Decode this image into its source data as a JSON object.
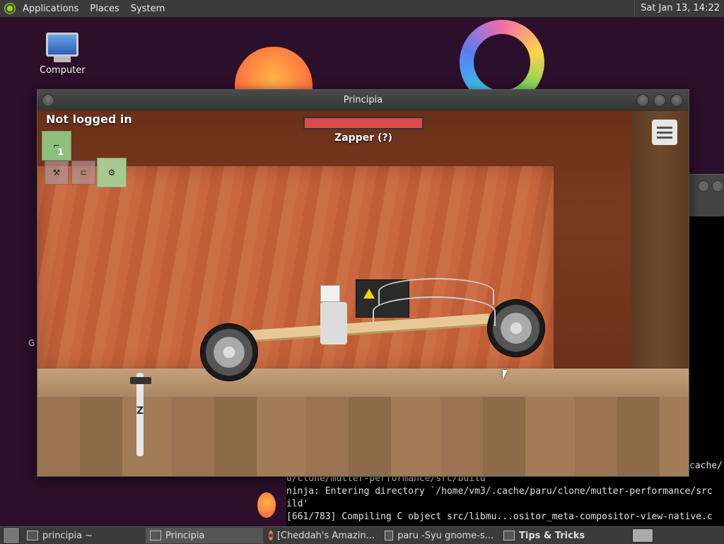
{
  "top_panel": {
    "menu": [
      "Applications",
      "Places",
      "System"
    ],
    "clock": "Sat Jan 13, 14:22"
  },
  "desktop": {
    "icons": [
      {
        "label": "Computer"
      }
    ],
    "stray_text": "G"
  },
  "window": {
    "title": "Principia"
  },
  "game": {
    "status": "Not logged in",
    "tool_name": "Zapper (?)",
    "slot_count": "1",
    "zoom_label": "Z"
  },
  "terminal": {
    "cache_fragment": "cache/",
    "lines": [
      "u/clone/mutter-performance/src/build",
      "ninja: Entering directory `/home/vm3/.cache/paru/clone/mutter-performance/src",
      "ild'",
      "[661/783] Compiling C object src/libmu...ositor_meta-compositor-view-native.c"
    ]
  },
  "taskbar": {
    "tasks": [
      {
        "label": "principia ~",
        "active": false
      },
      {
        "label": "Principia",
        "active": true
      },
      {
        "label": "[Cheddah's Amazin...",
        "active": false
      },
      {
        "label": "paru -Syu gnome-s...",
        "active": false
      },
      {
        "label": "Tips & Tricks",
        "active": false
      }
    ]
  }
}
